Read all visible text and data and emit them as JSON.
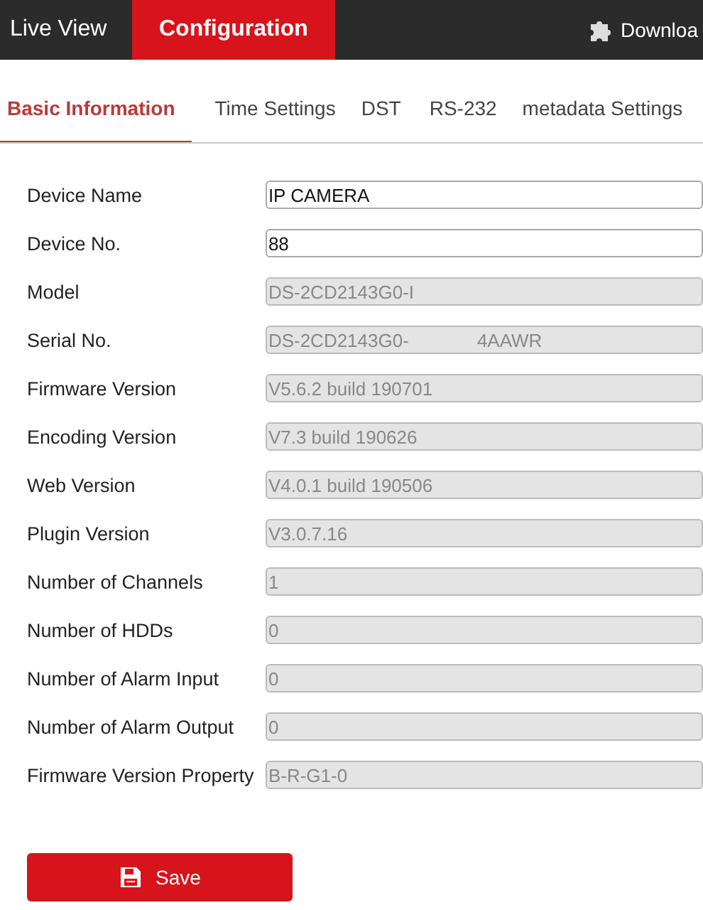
{
  "top_nav": [
    {
      "label": "Live View",
      "selected": false
    },
    {
      "label": "Configuration",
      "selected": true
    },
    {
      "label": "Downloa",
      "selected": false,
      "kind": "plugin"
    }
  ],
  "sub_tabs": [
    {
      "label": "Basic Information",
      "selected": true
    },
    {
      "label": "Time Settings",
      "selected": false
    },
    {
      "label": "DST",
      "selected": false
    },
    {
      "label": "RS-232",
      "selected": false
    },
    {
      "label": "metadata Settings",
      "selected": false
    }
  ],
  "fields": [
    {
      "label": "Device Name",
      "value": "IP CAMERA",
      "disabled": false
    },
    {
      "label": "Device No.",
      "value": "88",
      "disabled": false
    },
    {
      "label": "Model",
      "value": "DS-2CD2143G0-I",
      "disabled": true
    },
    {
      "label": "Serial No.",
      "value": "DS-2CD2143G0-",
      "value_after_redaction": "4AAWR",
      "disabled": true
    },
    {
      "label": "Firmware Version",
      "value": "V5.6.2 build 190701",
      "disabled": true
    },
    {
      "label": "Encoding Version",
      "value": "V7.3 build 190626",
      "disabled": true
    },
    {
      "label": "Web Version",
      "value": "V4.0.1 build 190506",
      "disabled": true
    },
    {
      "label": "Plugin Version",
      "value": "V3.0.7.16",
      "disabled": true
    },
    {
      "label": "Number of Channels",
      "value": "1",
      "disabled": true
    },
    {
      "label": "Number of HDDs",
      "value": "0",
      "disabled": true
    },
    {
      "label": "Number of Alarm Input",
      "value": "0",
      "disabled": true
    },
    {
      "label": "Number of Alarm Output",
      "value": "0",
      "disabled": true
    },
    {
      "label": "Firmware Version Property",
      "value": "B-R-G1-0",
      "disabled": true
    }
  ],
  "save_button": {
    "label": "Save"
  }
}
